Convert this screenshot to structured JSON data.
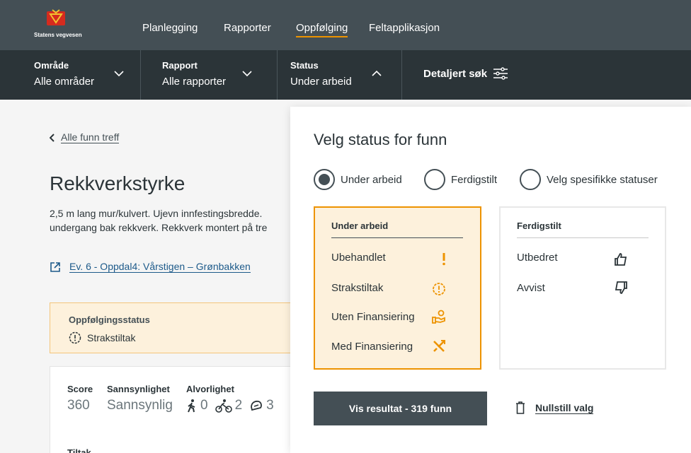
{
  "brand": {
    "name": "Statens vegvesen"
  },
  "nav": {
    "items": [
      {
        "label": "Planlegging"
      },
      {
        "label": "Rapporter"
      },
      {
        "label": "Oppfølging"
      },
      {
        "label": "Feltapplikasjon"
      }
    ],
    "active": "Oppfølging"
  },
  "filters": {
    "omrade": {
      "label": "Område",
      "value": "Alle områder"
    },
    "rapport": {
      "label": "Rapport",
      "value": "Alle rapporter"
    },
    "status": {
      "label": "Status",
      "value": "Under arbeid"
    },
    "detaljert": {
      "label": "Detaljert søk"
    }
  },
  "page": {
    "back_label": "Alle funn treff",
    "title": "Rekkverkstyrke",
    "description_line1": "2,5 m lang mur/kulvert. Ujevn innfestingsbredde.",
    "description_line2": "undergang bak rekkverk. Rekkverk montert på tre",
    "link_label": "Ev. 6 - Oppdal4: Vårstigen – Grønbakken",
    "followup": {
      "heading": "Oppfølgingsstatus",
      "value": "Strakstiltak"
    },
    "score": {
      "score_label": "Score",
      "score_value": "360",
      "prob_label": "Sannsynlighet",
      "prob_value": "Sannsynlig",
      "severity_label": "Alvorlighet",
      "pedestrian_count": "0",
      "cyclist_count": "2",
      "moped_count": "3"
    },
    "tiltak_label": "Tiltak"
  },
  "panel": {
    "title": "Velg status for funn",
    "radios": [
      {
        "label": "Under arbeid",
        "checked": true
      },
      {
        "label": "Ferdigstilt",
        "checked": false
      },
      {
        "label": "Velg spesifikke statuser",
        "checked": false
      }
    ],
    "under_arbeid": {
      "heading": "Under arbeid",
      "items": [
        {
          "label": "Ubehandlet",
          "icon": "exclamation-icon"
        },
        {
          "label": "Strakstiltak",
          "icon": "warning-circle-icon"
        },
        {
          "label": "Uten Finansiering",
          "icon": "hand-coin-icon"
        },
        {
          "label": "Med Finansiering",
          "icon": "tools-icon"
        }
      ]
    },
    "ferdigstilt": {
      "heading": "Ferdigstilt",
      "items": [
        {
          "label": "Utbedret",
          "icon": "thumbs-up-icon"
        },
        {
          "label": "Avvist",
          "icon": "thumbs-down-icon"
        }
      ]
    },
    "show_button": "Vis resultat - 319 funn",
    "reset_label": "Nullstill valg"
  },
  "colors": {
    "nav_bg": "#444f55",
    "filter_bg": "#2b3438",
    "accent": "#ed9300",
    "selected_bg": "#fdf1dc"
  }
}
